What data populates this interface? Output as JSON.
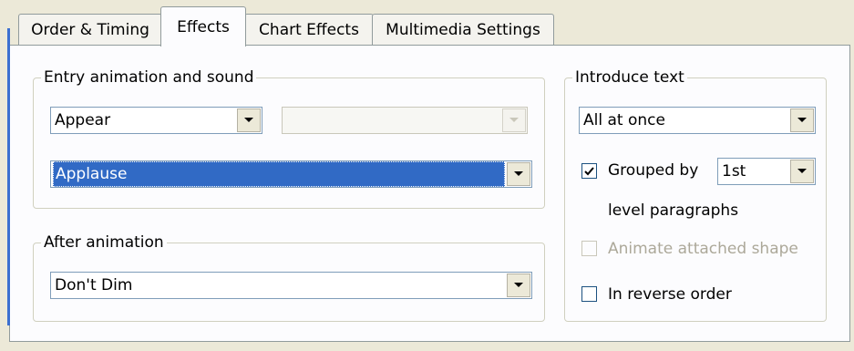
{
  "tabs": [
    {
      "label": "Order & Timing",
      "active": false
    },
    {
      "label": "Effects",
      "active": true
    },
    {
      "label": "Chart Effects",
      "active": false
    },
    {
      "label": "Multimedia Settings",
      "active": false
    }
  ],
  "entry": {
    "legend": "Entry animation and sound",
    "effect_value": "Appear",
    "direction_value": "",
    "sound_value": "Applause"
  },
  "after": {
    "legend": "After animation",
    "value": "Don't Dim"
  },
  "intro": {
    "legend": "Introduce text",
    "value": "All at once",
    "grouped_label": "Grouped by",
    "grouped_value": "1st",
    "grouped_checked": true,
    "level_label": "level paragraphs",
    "animate_shape_label": "Animate attached shape",
    "animate_shape_checked": false,
    "reverse_label": "In reverse order",
    "reverse_checked": false
  },
  "icons": {
    "dropdown": "chevron-down-icon",
    "check": "checkmark-icon"
  },
  "colors": {
    "selection": "#316ac5",
    "panel_bg": "#fcfcfe",
    "window_bg": "#ece9d8",
    "disabled_text": "#aca899"
  }
}
